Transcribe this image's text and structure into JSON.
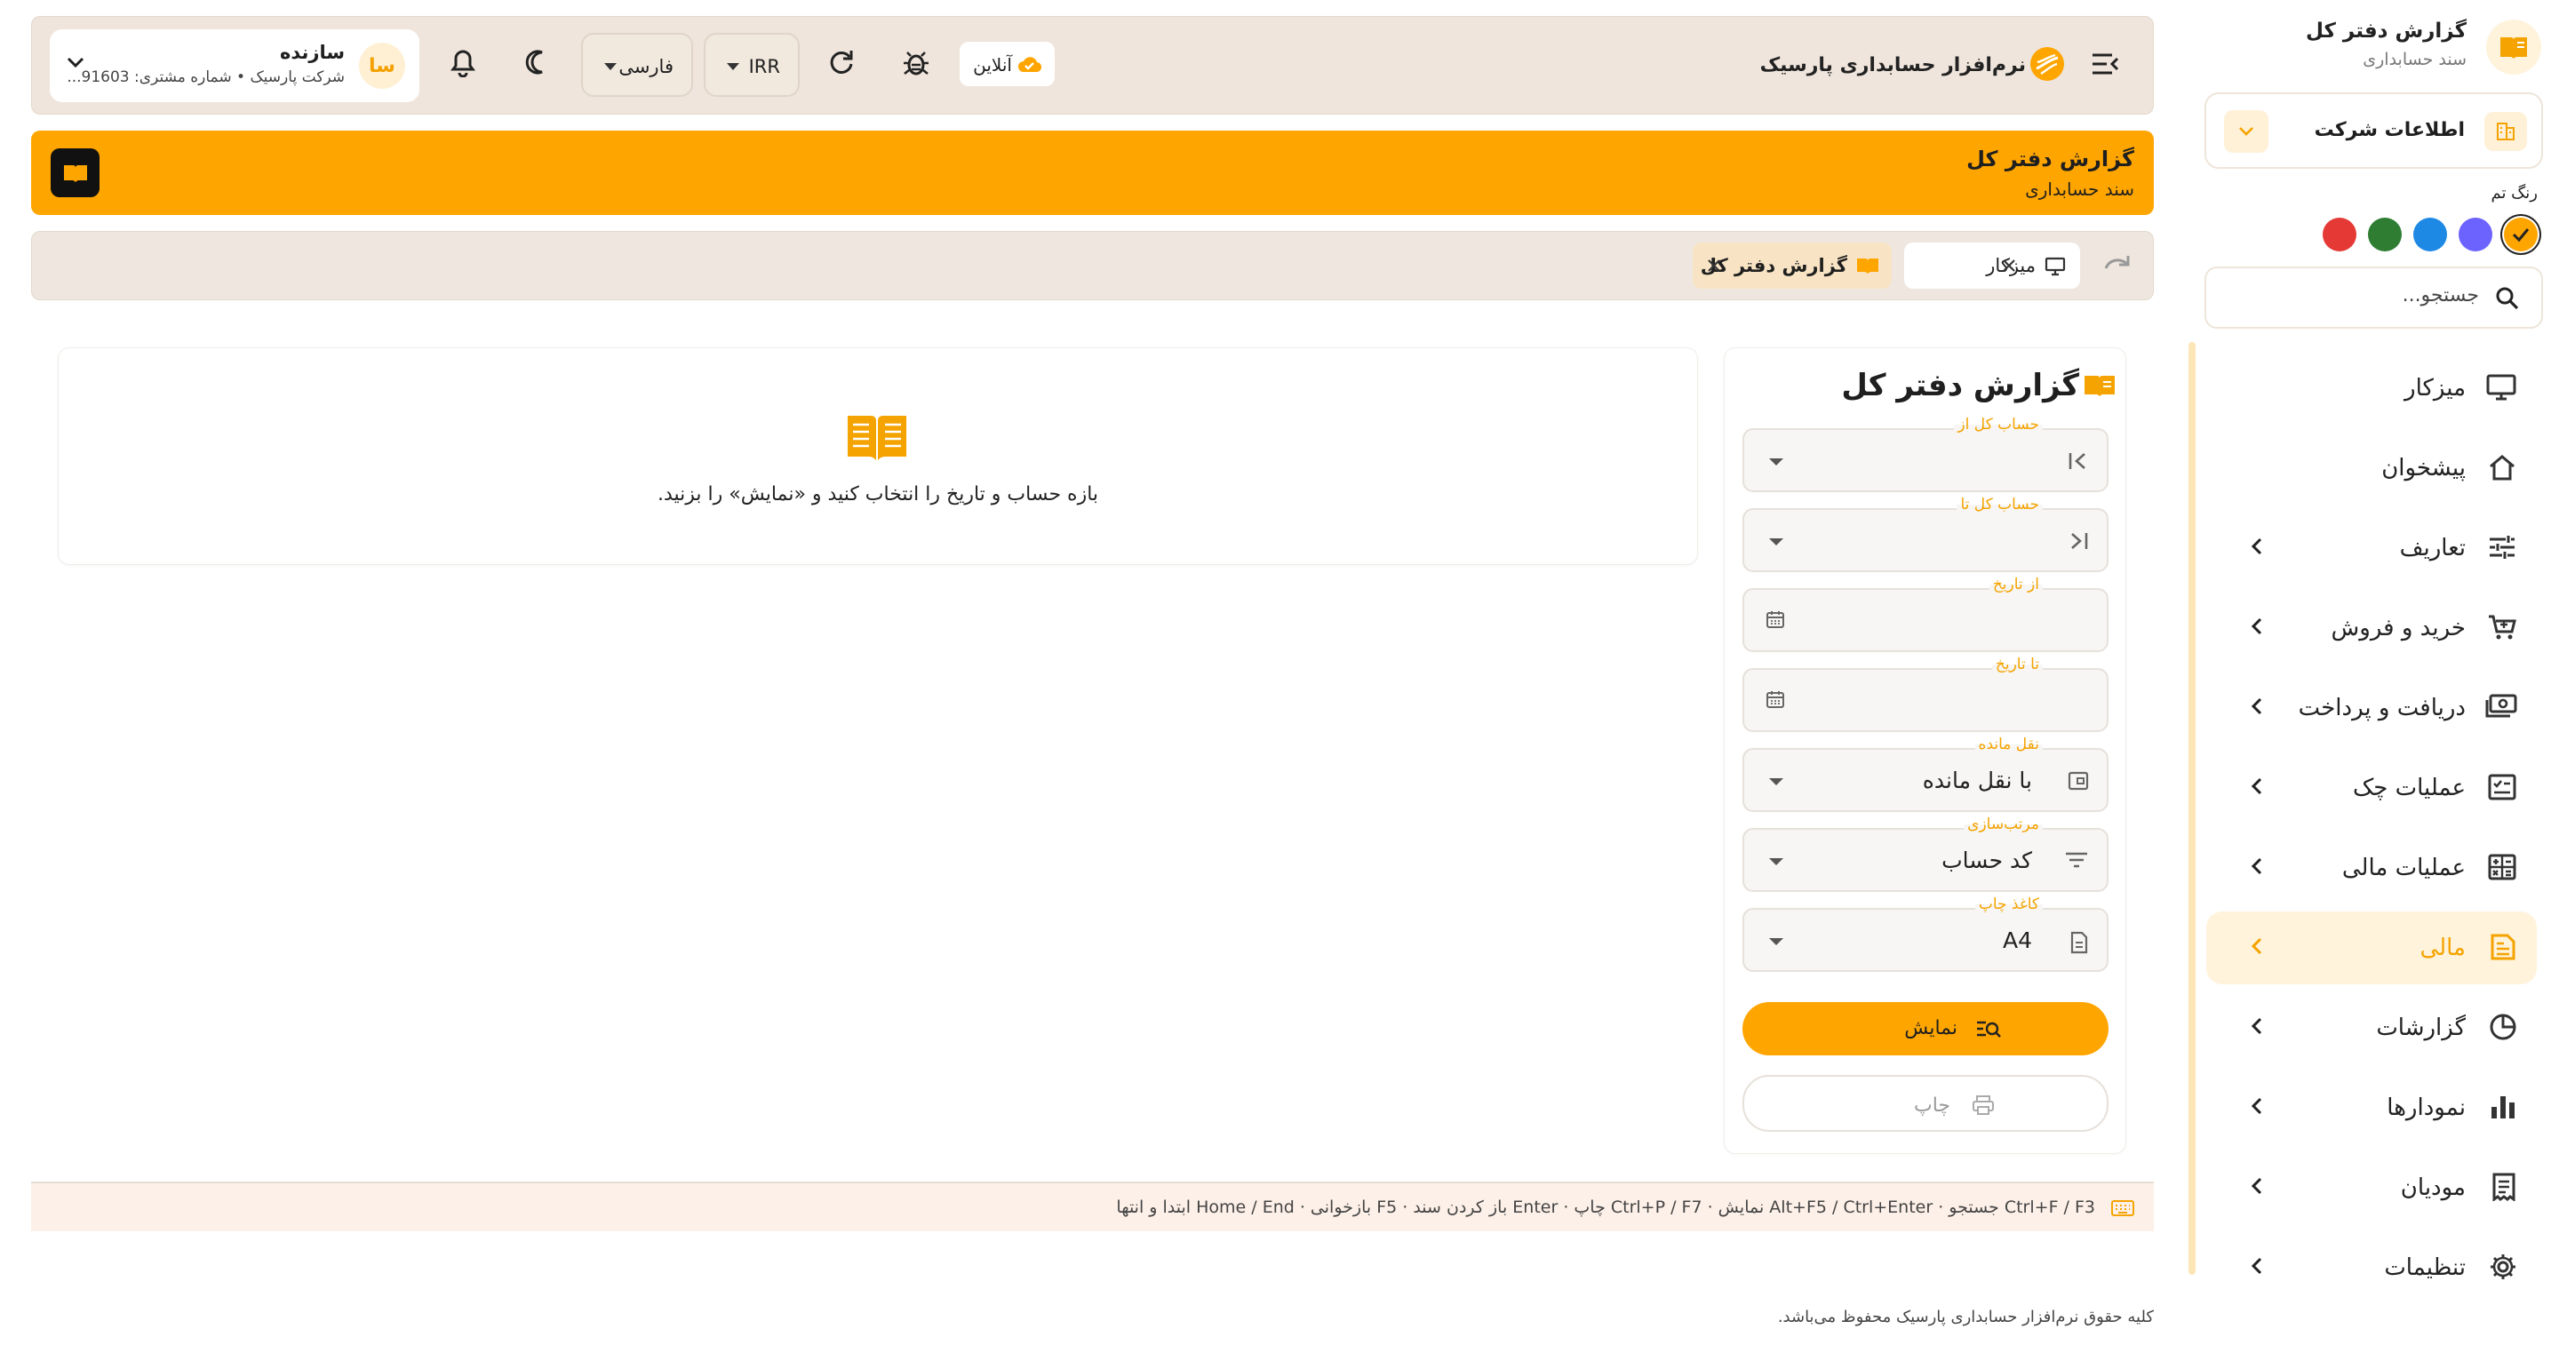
{
  "sidebar": {
    "header_title": "گزارش دفتر کل",
    "header_subtitle": "سند حسابداری",
    "company_label": "اطلاعات شرکت",
    "theme_label": "رنگ تم",
    "theme_colors": [
      "#ffa500",
      "#6c63ff",
      "#1e88e5",
      "#2e7d32",
      "#e53935"
    ],
    "selected_theme_color": "#ffa500",
    "search_placeholder": "جستجو...",
    "items": [
      {
        "label": "میزکار",
        "icon": "desktop-icon",
        "has_children": false,
        "active": false
      },
      {
        "label": "پیشخوان",
        "icon": "home-icon",
        "has_children": false,
        "active": false
      },
      {
        "label": "تعاریف",
        "icon": "sliders-icon",
        "has_children": true,
        "active": false
      },
      {
        "label": "خرید و فروش",
        "icon": "cart-icon",
        "has_children": true,
        "active": false
      },
      {
        "label": "دریافت و پرداخت",
        "icon": "cash-icon",
        "has_children": true,
        "active": false
      },
      {
        "label": "عملیات چک",
        "icon": "check-icon",
        "has_children": true,
        "active": false
      },
      {
        "label": "عملیات مالی",
        "icon": "calculator-icon",
        "has_children": true,
        "active": false
      },
      {
        "label": "مالی",
        "icon": "ledger-icon",
        "has_children": true,
        "active": true
      },
      {
        "label": "گزارشات",
        "icon": "pie-icon",
        "has_children": true,
        "active": false
      },
      {
        "label": "نمودارها",
        "icon": "bar-chart-icon",
        "has_children": true,
        "active": false
      },
      {
        "label": "مودیان",
        "icon": "receipt-icon",
        "has_children": true,
        "active": false
      },
      {
        "label": "تنظیمات",
        "icon": "gear-icon",
        "has_children": true,
        "active": false
      }
    ]
  },
  "topbar": {
    "brand_title": "نرم‌افزار حسابداری پارسیک",
    "online_label": "آنلاین",
    "currency": "IRR",
    "language": "فارسی",
    "user_avatar": "سا",
    "user_name": "سازنده",
    "user_subtitle": "شرکت پارسیک • شماره مشتری: 91603..."
  },
  "banner": {
    "title": "گزارش دفتر کل",
    "subtitle": "سند حسابداری"
  },
  "tabs": [
    {
      "label": "میزکار",
      "icon": "desktop-icon",
      "active": false
    },
    {
      "label": "گزارش دفتر کل",
      "icon": "book-icon",
      "active": true
    }
  ],
  "filter_panel": {
    "title": "گزارش دفتر کل",
    "fields": [
      {
        "label": "حساب کل از",
        "value": "",
        "icon": "first-page-icon"
      },
      {
        "label": "حساب کل تا",
        "value": "",
        "icon": "last-page-icon"
      },
      {
        "label": "از تاریخ",
        "value": "",
        "icon": "calendar-icon"
      },
      {
        "label": "تا تاریخ",
        "value": "",
        "icon": "calendar-icon"
      },
      {
        "label": "نقل مانده",
        "value": "با نقل مانده",
        "icon": "balance-icon"
      },
      {
        "label": "مرتب‌سازی",
        "value": "کد حساب",
        "icon": "sort-icon"
      },
      {
        "label": "کاغذ چاپ",
        "value": "A4",
        "icon": "document-icon"
      }
    ],
    "show_button": "نمایش",
    "print_button": "چاپ"
  },
  "info": {
    "message": "بازه حساب و تاریخ را انتخاب کنید و «نمایش» را بزنید."
  },
  "shortcuts_text": "Ctrl+F / F3 جستجو · Alt+F5 / Ctrl+Enter نمایش · Ctrl+P / F7 چاپ · Enter باز کردن سند · F5 بازخوانی · Home / End ابتدا و انتها",
  "footer": "کلیه حقوق نرم‌افزار حسابداری پارسیک محفوظ می‌باشد.",
  "colors": {
    "accent": "#ffa500",
    "topbar_bg": "#efe5dc",
    "active_nav_bg": "#fff3dc"
  }
}
